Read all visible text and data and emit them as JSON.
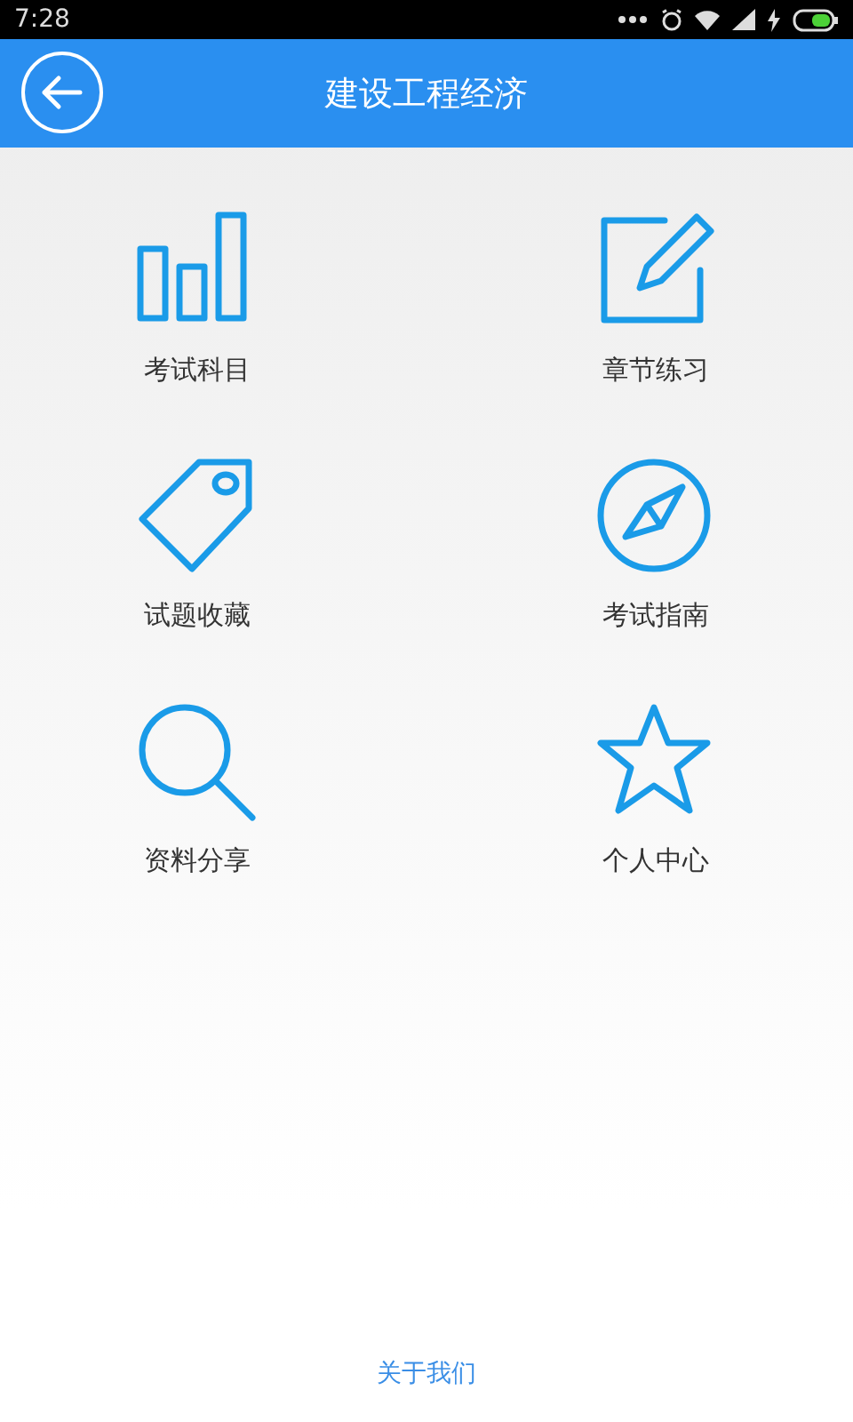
{
  "status_bar": {
    "time": "7:28"
  },
  "header": {
    "title": "建设工程经济"
  },
  "menu": [
    {
      "label": "考试科目",
      "kind": "bars"
    },
    {
      "label": "章节练习",
      "kind": "edit"
    },
    {
      "label": "试题收藏",
      "kind": "tag"
    },
    {
      "label": "考试指南",
      "kind": "compass"
    },
    {
      "label": "资料分享",
      "kind": "search"
    },
    {
      "label": "个人中心",
      "kind": "star"
    }
  ],
  "footer": {
    "link": "关于我们"
  }
}
